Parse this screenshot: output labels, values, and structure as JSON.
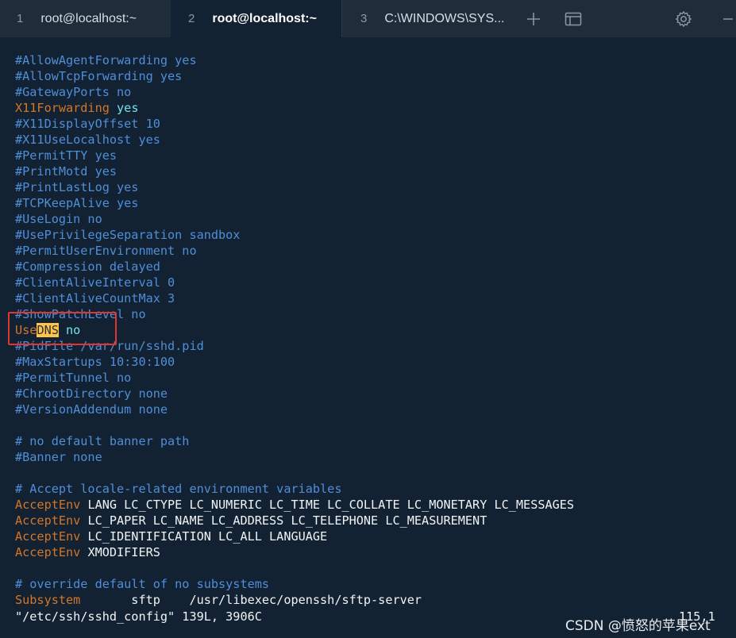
{
  "tabs": [
    {
      "number": "1",
      "label": "root@localhost:~",
      "active": false
    },
    {
      "number": "2",
      "label": "root@localhost:~",
      "active": true
    },
    {
      "number": "3",
      "label": "C:\\WINDOWS\\SYS...",
      "active": false
    }
  ],
  "toolbar": {
    "new_tab_icon": "plus-icon",
    "panes_icon": "window-panes-icon",
    "settings_icon": "gear-icon",
    "minimize_icon": "minimize-icon"
  },
  "colors": {
    "background": "#132232",
    "comment": "#4f8ed8",
    "keyword": "#d3762a",
    "value": "#6fe3ec",
    "plain": "#f1f4f6",
    "highlight": "#ffc24a",
    "annotation_box": "#e5332f"
  },
  "terminal": {
    "lines": [
      [
        {
          "t": "#AllowAgentForwarding yes",
          "c": "comment"
        }
      ],
      [
        {
          "t": "#AllowTcpForwarding yes",
          "c": "comment"
        }
      ],
      [
        {
          "t": "#GatewayPorts no",
          "c": "comment"
        }
      ],
      [
        {
          "t": "X11Forwarding",
          "c": "key"
        },
        {
          "t": " ",
          "c": "plain"
        },
        {
          "t": "yes",
          "c": "val"
        }
      ],
      [
        {
          "t": "#X11DisplayOffset 10",
          "c": "comment"
        }
      ],
      [
        {
          "t": "#X11UseLocalhost yes",
          "c": "comment"
        }
      ],
      [
        {
          "t": "#PermitTTY yes",
          "c": "comment"
        }
      ],
      [
        {
          "t": "#PrintMotd yes",
          "c": "comment"
        }
      ],
      [
        {
          "t": "#PrintLastLog yes",
          "c": "comment"
        }
      ],
      [
        {
          "t": "#TCPKeepAlive yes",
          "c": "comment"
        }
      ],
      [
        {
          "t": "#UseLogin no",
          "c": "comment"
        }
      ],
      [
        {
          "t": "#UsePrivilegeSeparation sandbox",
          "c": "comment"
        }
      ],
      [
        {
          "t": "#PermitUserEnvironment no",
          "c": "comment"
        }
      ],
      [
        {
          "t": "#Compression delayed",
          "c": "comment"
        }
      ],
      [
        {
          "t": "#ClientAliveInterval 0",
          "c": "comment"
        }
      ],
      [
        {
          "t": "#ClientAliveCountMax 3",
          "c": "comment"
        }
      ],
      [
        {
          "t": "#ShowPatchLevel no",
          "c": "comment"
        }
      ],
      [
        {
          "t": "Use",
          "c": "key"
        },
        {
          "t": "DNS",
          "c": "hl"
        },
        {
          "t": " ",
          "c": "plain"
        },
        {
          "t": "no",
          "c": "val"
        }
      ],
      [
        {
          "t": "#PidFile /var/run/sshd.pid",
          "c": "comment"
        }
      ],
      [
        {
          "t": "#MaxStartups 10:30:100",
          "c": "comment"
        }
      ],
      [
        {
          "t": "#PermitTunnel no",
          "c": "comment"
        }
      ],
      [
        {
          "t": "#ChrootDirectory none",
          "c": "comment"
        }
      ],
      [
        {
          "t": "#VersionAddendum none",
          "c": "comment"
        }
      ],
      [
        {
          "t": "",
          "c": "plain"
        }
      ],
      [
        {
          "t": "# no default banner path",
          "c": "comment"
        }
      ],
      [
        {
          "t": "#Banner none",
          "c": "comment"
        }
      ],
      [
        {
          "t": "",
          "c": "plain"
        }
      ],
      [
        {
          "t": "# Accept locale-related environment variables",
          "c": "comment"
        }
      ],
      [
        {
          "t": "AcceptEnv",
          "c": "key"
        },
        {
          "t": " LANG LC_CTYPE LC_NUMERIC LC_TIME LC_COLLATE LC_MONETARY LC_MESSAGES",
          "c": "plain"
        }
      ],
      [
        {
          "t": "AcceptEnv",
          "c": "key"
        },
        {
          "t": " LC_PAPER LC_NAME LC_ADDRESS LC_TELEPHONE LC_MEASUREMENT",
          "c": "plain"
        }
      ],
      [
        {
          "t": "AcceptEnv",
          "c": "key"
        },
        {
          "t": " LC_IDENTIFICATION LC_ALL LANGUAGE",
          "c": "plain"
        }
      ],
      [
        {
          "t": "AcceptEnv",
          "c": "key"
        },
        {
          "t": " XMODIFIERS",
          "c": "plain"
        }
      ],
      [
        {
          "t": "",
          "c": "plain"
        }
      ],
      [
        {
          "t": "# override default of no subsystems",
          "c": "comment"
        }
      ],
      [
        {
          "t": "Subsystem",
          "c": "key"
        },
        {
          "t": "       sftp    /usr/libexec/openssh/sftp-server",
          "c": "plain"
        }
      ]
    ],
    "status_line": "\"/etc/ssh/sshd_config\" 139L, 3906C",
    "cursor_position": "115,1"
  },
  "watermark": "CSDN @愤怒的苹果ext"
}
